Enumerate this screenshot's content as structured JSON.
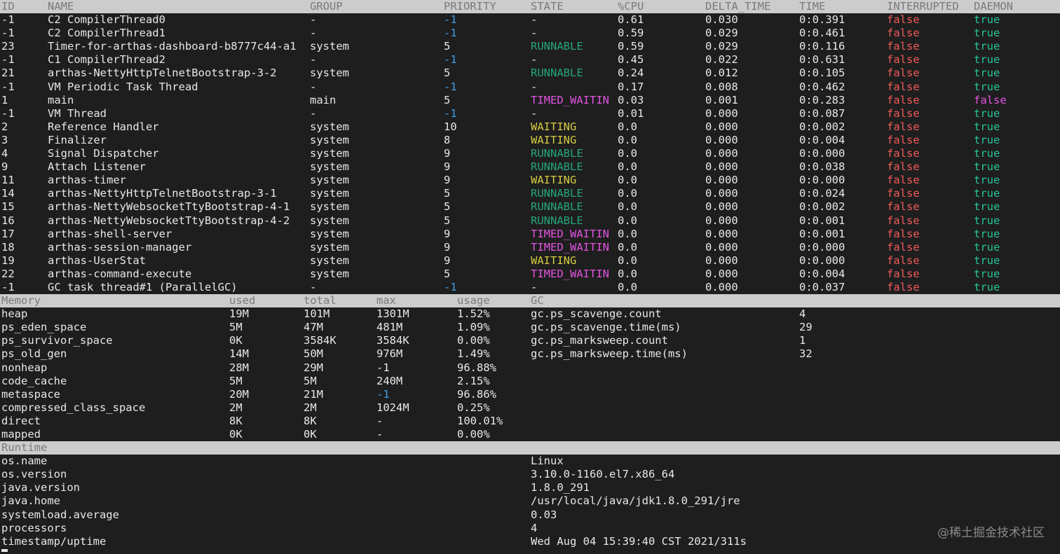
{
  "thread_table": {
    "headers": [
      "ID",
      "NAME",
      "GROUP",
      "PRIORITY",
      "STATE",
      "%CPU",
      "DELTA_TIME",
      "TIME",
      "INTERRUPTED",
      "DAEMON"
    ],
    "rows": [
      {
        "id": "-1",
        "name": "C2 CompilerThread0",
        "group": "-",
        "priority": "-1",
        "state": "-",
        "cpu": "0.61",
        "delta": "0.030",
        "time": "0:0.391",
        "interrupted": "false",
        "daemon": "true"
      },
      {
        "id": "-1",
        "name": "C2 CompilerThread1",
        "group": "-",
        "priority": "-1",
        "state": "-",
        "cpu": "0.59",
        "delta": "0.029",
        "time": "0:0.461",
        "interrupted": "false",
        "daemon": "true"
      },
      {
        "id": "23",
        "name": "Timer-for-arthas-dashboard-b8777c44-a1",
        "group": "system",
        "priority": "5",
        "state": "RUNNABLE",
        "cpu": "0.59",
        "delta": "0.029",
        "time": "0:0.116",
        "interrupted": "false",
        "daemon": "true"
      },
      {
        "id": "-1",
        "name": "C1 CompilerThread2",
        "group": "-",
        "priority": "-1",
        "state": "-",
        "cpu": "0.45",
        "delta": "0.022",
        "time": "0:0.631",
        "interrupted": "false",
        "daemon": "true"
      },
      {
        "id": "21",
        "name": "arthas-NettyHttpTelnetBootstrap-3-2",
        "group": "system",
        "priority": "5",
        "state": "RUNNABLE",
        "cpu": "0.24",
        "delta": "0.012",
        "time": "0:0.105",
        "interrupted": "false",
        "daemon": "true"
      },
      {
        "id": "-1",
        "name": "VM Periodic Task Thread",
        "group": "-",
        "priority": "-1",
        "state": "-",
        "cpu": "0.17",
        "delta": "0.008",
        "time": "0:0.462",
        "interrupted": "false",
        "daemon": "true"
      },
      {
        "id": "1",
        "name": "main",
        "group": "main",
        "priority": "5",
        "state": "TIMED_WAITIN",
        "cpu": "0.03",
        "delta": "0.001",
        "time": "0:0.283",
        "interrupted": "false",
        "daemon": "false"
      },
      {
        "id": "-1",
        "name": "VM Thread",
        "group": "-",
        "priority": "-1",
        "state": "-",
        "cpu": "0.01",
        "delta": "0.000",
        "time": "0:0.087",
        "interrupted": "false",
        "daemon": "true"
      },
      {
        "id": "2",
        "name": "Reference Handler",
        "group": "system",
        "priority": "10",
        "state": "WAITING",
        "cpu": "0.0",
        "delta": "0.000",
        "time": "0:0.002",
        "interrupted": "false",
        "daemon": "true"
      },
      {
        "id": "3",
        "name": "Finalizer",
        "group": "system",
        "priority": "8",
        "state": "WAITING",
        "cpu": "0.0",
        "delta": "0.000",
        "time": "0:0.004",
        "interrupted": "false",
        "daemon": "true"
      },
      {
        "id": "4",
        "name": "Signal Dispatcher",
        "group": "system",
        "priority": "9",
        "state": "RUNNABLE",
        "cpu": "0.0",
        "delta": "0.000",
        "time": "0:0.000",
        "interrupted": "false",
        "daemon": "true"
      },
      {
        "id": "9",
        "name": "Attach Listener",
        "group": "system",
        "priority": "9",
        "state": "RUNNABLE",
        "cpu": "0.0",
        "delta": "0.000",
        "time": "0:0.038",
        "interrupted": "false",
        "daemon": "true"
      },
      {
        "id": "11",
        "name": "arthas-timer",
        "group": "system",
        "priority": "9",
        "state": "WAITING",
        "cpu": "0.0",
        "delta": "0.000",
        "time": "0:0.000",
        "interrupted": "false",
        "daemon": "true"
      },
      {
        "id": "14",
        "name": "arthas-NettyHttpTelnetBootstrap-3-1",
        "group": "system",
        "priority": "5",
        "state": "RUNNABLE",
        "cpu": "0.0",
        "delta": "0.000",
        "time": "0:0.024",
        "interrupted": "false",
        "daemon": "true"
      },
      {
        "id": "15",
        "name": "arthas-NettyWebsocketTtyBootstrap-4-1",
        "group": "system",
        "priority": "5",
        "state": "RUNNABLE",
        "cpu": "0.0",
        "delta": "0.000",
        "time": "0:0.002",
        "interrupted": "false",
        "daemon": "true"
      },
      {
        "id": "16",
        "name": "arthas-NettyWebsocketTtyBootstrap-4-2",
        "group": "system",
        "priority": "5",
        "state": "RUNNABLE",
        "cpu": "0.0",
        "delta": "0.000",
        "time": "0:0.001",
        "interrupted": "false",
        "daemon": "true"
      },
      {
        "id": "17",
        "name": "arthas-shell-server",
        "group": "system",
        "priority": "9",
        "state": "TIMED_WAITIN",
        "cpu": "0.0",
        "delta": "0.000",
        "time": "0:0.001",
        "interrupted": "false",
        "daemon": "true"
      },
      {
        "id": "18",
        "name": "arthas-session-manager",
        "group": "system",
        "priority": "9",
        "state": "TIMED_WAITIN",
        "cpu": "0.0",
        "delta": "0.000",
        "time": "0:0.000",
        "interrupted": "false",
        "daemon": "true"
      },
      {
        "id": "19",
        "name": "arthas-UserStat",
        "group": "system",
        "priority": "9",
        "state": "WAITING",
        "cpu": "0.0",
        "delta": "0.000",
        "time": "0:0.000",
        "interrupted": "false",
        "daemon": "true"
      },
      {
        "id": "22",
        "name": "arthas-command-execute",
        "group": "system",
        "priority": "5",
        "state": "TIMED_WAITIN",
        "cpu": "0.0",
        "delta": "0.000",
        "time": "0:0.004",
        "interrupted": "false",
        "daemon": "true"
      },
      {
        "id": "-1",
        "name": "GC task thread#1 (ParallelGC)",
        "group": "-",
        "priority": "-1",
        "state": "-",
        "cpu": "0.0",
        "delta": "0.000",
        "time": "0:0.037",
        "interrupted": "false",
        "daemon": "true"
      }
    ]
  },
  "memory": {
    "headers": [
      "Memory",
      "used",
      "total",
      "max",
      "usage",
      "GC"
    ],
    "rows": [
      {
        "name": "heap",
        "used": "19M",
        "total": "101M",
        "max": "1301M",
        "usage": "1.52%",
        "gc_key": "gc.ps_scavenge.count",
        "gc_val": "4"
      },
      {
        "name": "ps_eden_space",
        "used": "5M",
        "total": "47M",
        "max": "481M",
        "usage": "1.09%",
        "gc_key": "gc.ps_scavenge.time(ms)",
        "gc_val": "29"
      },
      {
        "name": "ps_survivor_space",
        "used": "0K",
        "total": "3584K",
        "max": "3584K",
        "usage": "0.00%",
        "gc_key": "gc.ps_marksweep.count",
        "gc_val": "1"
      },
      {
        "name": "ps_old_gen",
        "used": "14M",
        "total": "50M",
        "max": "976M",
        "usage": "1.49%",
        "gc_key": "gc.ps_marksweep.time(ms)",
        "gc_val": "32"
      },
      {
        "name": "nonheap",
        "used": "28M",
        "total": "29M",
        "max": "-1",
        "usage": "96.88%",
        "gc_key": "",
        "gc_val": ""
      },
      {
        "name": "code_cache",
        "used": "5M",
        "total": "5M",
        "max": "240M",
        "usage": "2.15%",
        "gc_key": "",
        "gc_val": ""
      },
      {
        "name": "metaspace",
        "used": "20M",
        "total": "21M",
        "max": "-1",
        "usage": "96.86%",
        "gc_key": "",
        "gc_val": ""
      },
      {
        "name": "compressed_class_space",
        "used": "2M",
        "total": "2M",
        "max": "1024M",
        "usage": "0.25%",
        "gc_key": "",
        "gc_val": ""
      },
      {
        "name": "direct",
        "used": "8K",
        "total": "8K",
        "max": "-",
        "usage": "100.01%",
        "gc_key": "",
        "gc_val": ""
      },
      {
        "name": "mapped",
        "used": "0K",
        "total": "0K",
        "max": "-",
        "usage": "0.00%",
        "gc_key": "",
        "gc_val": ""
      }
    ]
  },
  "runtime": {
    "header": "Runtime",
    "rows": [
      {
        "key": "os.name",
        "val": "Linux"
      },
      {
        "key": "os.version",
        "val": "3.10.0-1160.el7.x86_64"
      },
      {
        "key": "java.version",
        "val": "1.8.0_291"
      },
      {
        "key": "java.home",
        "val": "/usr/local/java/jdk1.8.0_291/jre"
      },
      {
        "key": "systemload.average",
        "val": "0.03"
      },
      {
        "key": "processors",
        "val": "4"
      },
      {
        "key": "timestamp/uptime",
        "val": "Wed Aug 04 15:39:40 CST 2021/311s"
      }
    ]
  },
  "watermark": "@稀土掘金技术社区",
  "colors": {
    "background": "#1e1e1e",
    "header_bar": "#cccccc",
    "negative_priority": "#3b9ee8",
    "runnable": "#26a57b",
    "waiting": "#d6cb43",
    "timed_waiting": "#e353e3",
    "false": "#f25a5a",
    "true": "#27c499"
  }
}
